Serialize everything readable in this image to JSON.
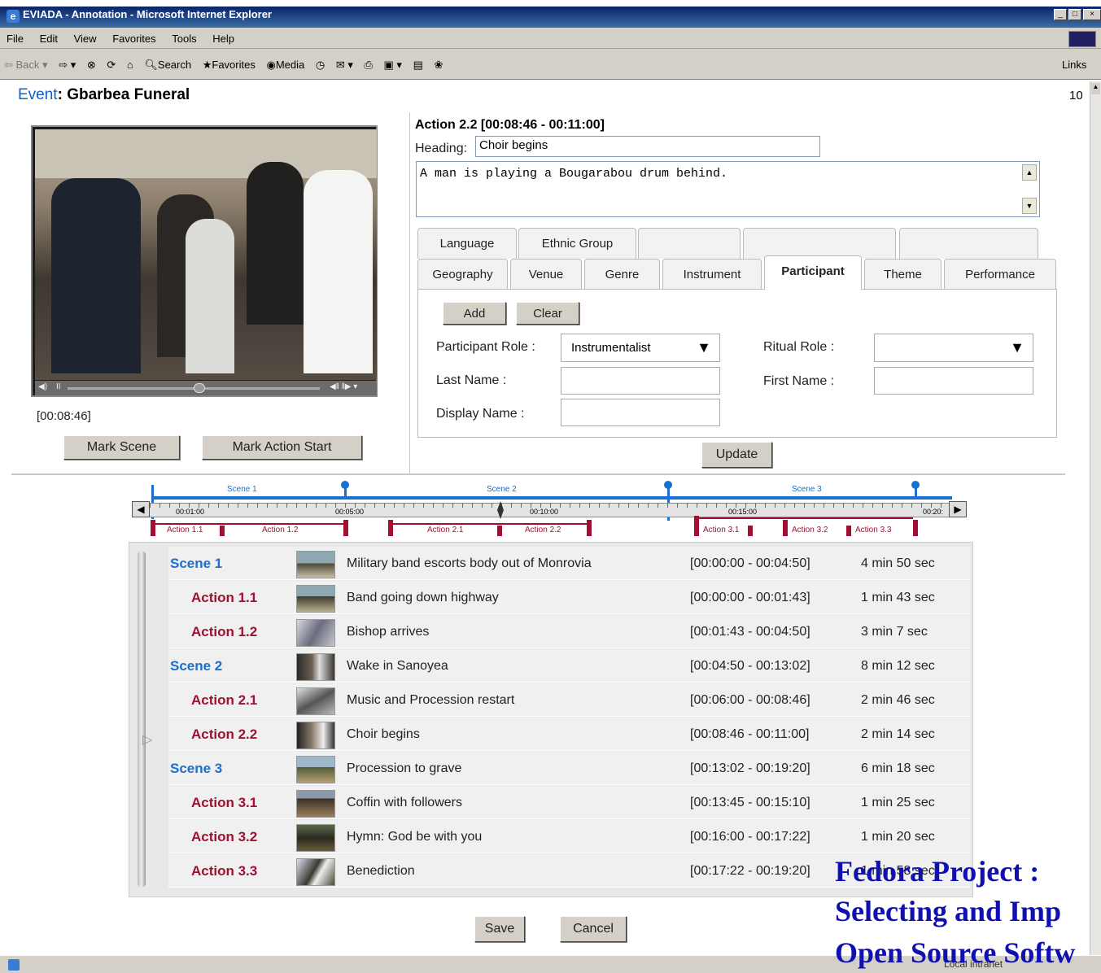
{
  "window": {
    "title": "EVIADA - Annotation - Microsoft Internet Explorer"
  },
  "menu": [
    "File",
    "Edit",
    "View",
    "Favorites",
    "Tools",
    "Help"
  ],
  "toolbar": {
    "back": "Back",
    "search": "Search",
    "favorites": "Favorites",
    "media": "Media",
    "links": "Links"
  },
  "event": {
    "label": "Event",
    "name": "Gbarbea Funeral",
    "corner_number": "10"
  },
  "video": {
    "timecode": "[00:08:46]"
  },
  "buttons": {
    "mark_scene": "Mark Scene",
    "mark_action": "Mark Action Start",
    "add": "Add",
    "clear": "Clear",
    "update": "Update",
    "save": "Save",
    "cancel": "Cancel"
  },
  "action": {
    "title": "Action 2.2 [00:08:46 - 00:11:00]",
    "heading_label": "Heading:",
    "heading_value": "Choir begins",
    "description": "A man is playing a Bougarabou drum behind."
  },
  "tabs_back": [
    "Language",
    "Ethnic Group",
    "",
    "",
    ""
  ],
  "tabs_front": [
    "Geography",
    "Venue",
    "Genre",
    "Instrument",
    "Participant",
    "Theme",
    "Performance"
  ],
  "participant_form": {
    "role_label": "Participant Role :",
    "role_value": "Instrumentalist",
    "ritual_label": "Ritual Role :",
    "ritual_value": "",
    "last_label": "Last Name :",
    "first_label": "First Name :",
    "display_label": "Display Name :"
  },
  "timeline": {
    "scenes": [
      "Scene 1",
      "Scene 2",
      "Scene 3"
    ],
    "ticks": [
      "00:01:00",
      "00:05:00",
      "00:10:00",
      "00:15:00",
      "00:20:"
    ],
    "actions": [
      "Action 1.1",
      "Action 1.2",
      "Action 2.1",
      "Action 2.2",
      "Action 3.1",
      "Action 3.2",
      "Action 3.3"
    ]
  },
  "rows": [
    {
      "kind": "scene",
      "id": "Scene 1",
      "desc": "Military band escorts body out of Monrovia",
      "range": "[00:00:00 - 00:04:50]",
      "dur": "4 min 50 sec"
    },
    {
      "kind": "action",
      "id": "Action 1.1",
      "desc": "Band going down highway",
      "range": "[00:00:00 - 00:01:43]",
      "dur": "1 min 43 sec"
    },
    {
      "kind": "action",
      "id": "Action 1.2",
      "desc": "Bishop arrives",
      "range": "[00:01:43 - 00:04:50]",
      "dur": "3 min 7 sec"
    },
    {
      "kind": "scene",
      "id": "Scene 2",
      "desc": "Wake in Sanoyea",
      "range": "[00:04:50 - 00:13:02]",
      "dur": "8 min 12 sec"
    },
    {
      "kind": "action",
      "id": "Action 2.1",
      "desc": "Music and Procession restart",
      "range": "[00:06:00 - 00:08:46]",
      "dur": "2 min 46 sec"
    },
    {
      "kind": "action",
      "id": "Action 2.2",
      "desc": "Choir begins",
      "range": "[00:08:46 - 00:11:00]",
      "dur": "2 min 14 sec"
    },
    {
      "kind": "scene",
      "id": "Scene 3",
      "desc": "Procession to grave",
      "range": "[00:13:02 - 00:19:20]",
      "dur": "6 min 18 sec"
    },
    {
      "kind": "action",
      "id": "Action 3.1",
      "desc": "Coffin with followers",
      "range": "[00:13:45 - 00:15:10]",
      "dur": "1 min 25 sec"
    },
    {
      "kind": "action",
      "id": "Action 3.2",
      "desc": "Hymn: God be with you",
      "range": "[00:16:00 - 00:17:22]",
      "dur": "1 min 20 sec"
    },
    {
      "kind": "action",
      "id": "Action 3.3",
      "desc": "Benediction",
      "range": "[00:17:22 - 00:19:20]",
      "dur": "1 min 58 sec"
    }
  ],
  "overlay": [
    "Fedora Project :",
    "Selecting and Imp",
    "Open Source Softw"
  ],
  "status": {
    "zone": "Local intranet"
  },
  "colors": {
    "scene_blue": "#1a6fd0",
    "action_red": "#a01030",
    "titlebar": "#0a246a",
    "overlay_text": "#1010b0"
  }
}
